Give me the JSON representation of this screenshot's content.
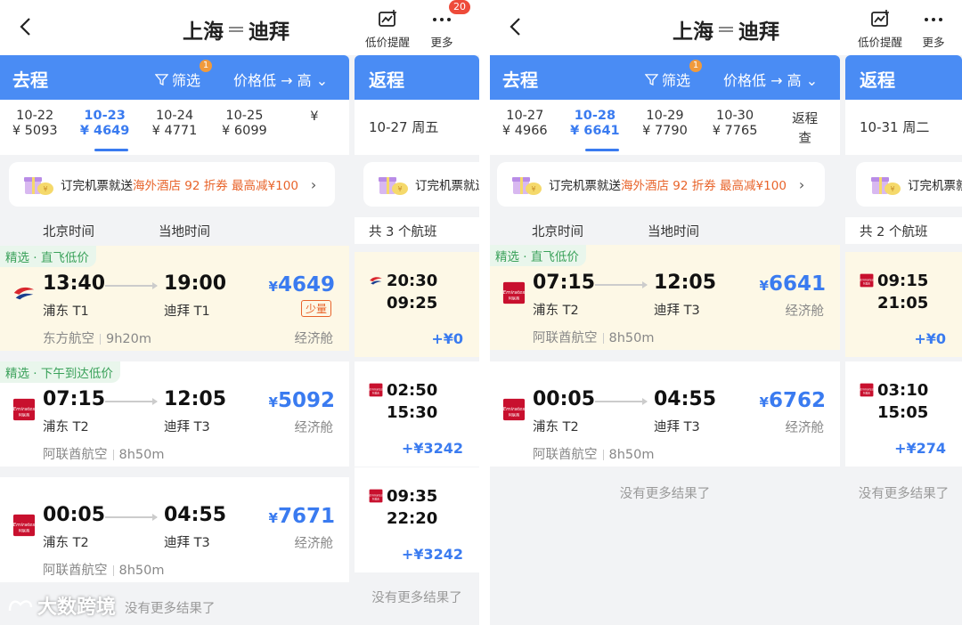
{
  "left": {
    "route_from": "上海",
    "route_to": "迪拜",
    "price_alert_label": "低价提醒",
    "more_label": "更多",
    "more_badge": "20",
    "outbound_label": "去程",
    "filter_label": "筛选",
    "filter_badge": "1",
    "sort_label": "价格低 → 高",
    "return_label": "返程",
    "dates": [
      {
        "date": "10-22",
        "price": "¥ 5093"
      },
      {
        "date": "10-23",
        "price": "¥ 4649"
      },
      {
        "date": "10-24",
        "price": "¥ 4771"
      },
      {
        "date": "10-25",
        "price": "¥ 6099"
      },
      {
        "date": "",
        "price": "¥"
      }
    ],
    "active_date_index": 1,
    "return_date": "10-27 周五",
    "promo_prefix": "订完机票就送",
    "promo_highlight": "海外酒店 92 折券 最高减¥100",
    "promo_short": "订完机票就送",
    "col_beijing": "北京时间",
    "col_local": "当地时间",
    "return_count": "共 3 个航班",
    "flights": [
      {
        "tag": "精选 · 直飞低价",
        "dep": "13:40",
        "arr": "19:00",
        "dep_ap": "浦东 T1",
        "arr_ap": "迪拜 T1",
        "price": "4649",
        "few": "少量",
        "airline": "东方航空",
        "duration": "9h20m",
        "cabin": "经济舱",
        "logo": "china-eastern"
      },
      {
        "tag": "精选 · 下午到达低价",
        "dep": "07:15",
        "arr": "12:05",
        "dep_ap": "浦东 T2",
        "arr_ap": "迪拜 T3",
        "price": "5092",
        "airline": "阿联酋航空",
        "duration": "8h50m",
        "cabin": "经济舱",
        "logo": "emirates"
      },
      {
        "tag": "",
        "dep": "00:05",
        "arr": "04:55",
        "dep_ap": "浦东 T2",
        "arr_ap": "迪拜 T3",
        "price": "7671",
        "airline": "阿联酋航空",
        "duration": "8h50m",
        "cabin": "经济舱",
        "logo": "emirates"
      }
    ],
    "returns": [
      {
        "dep": "20:30",
        "arr": "09:25",
        "diff": "+¥0",
        "logo": "china-eastern"
      },
      {
        "dep": "02:50",
        "arr": "15:30",
        "diff": "+¥3242",
        "logo": "emirates"
      },
      {
        "dep": "09:35",
        "arr": "22:20",
        "diff": "+¥3242",
        "logo": "emirates"
      }
    ],
    "no_more": "没有更多结果了",
    "watermark": "大数跨境"
  },
  "right": {
    "route_from": "上海",
    "route_to": "迪拜",
    "price_alert_label": "低价提醒",
    "more_label": "更多",
    "outbound_label": "去程",
    "filter_label": "筛选",
    "filter_badge": "1",
    "sort_label": "价格低 → 高",
    "return_label": "返程",
    "dates": [
      {
        "date": "10-27",
        "price": "¥ 4966"
      },
      {
        "date": "10-28",
        "price": "¥ 6641"
      },
      {
        "date": "10-29",
        "price": "¥ 7790"
      },
      {
        "date": "10-30",
        "price": "¥ 7765"
      },
      {
        "date": "返程",
        "price": "查"
      }
    ],
    "active_date_index": 1,
    "return_date": "10-31 周二",
    "promo_prefix": "订完机票就送",
    "promo_highlight": "海外酒店 92 折券 最高减¥100",
    "promo_short": "订完机票就",
    "col_beijing": "北京时间",
    "col_local": "当地时间",
    "return_count": "共 2 个航班",
    "flights": [
      {
        "tag": "精选 · 直飞低价",
        "dep": "07:15",
        "arr": "12:05",
        "dep_ap": "浦东 T2",
        "arr_ap": "迪拜 T3",
        "price": "6641",
        "airline": "阿联酋航空",
        "duration": "8h50m",
        "cabin": "经济舱",
        "logo": "emirates"
      },
      {
        "tag": "",
        "dep": "00:05",
        "arr": "04:55",
        "dep_ap": "浦东 T2",
        "arr_ap": "迪拜 T3",
        "price": "6762",
        "airline": "阿联酋航空",
        "duration": "8h50m",
        "cabin": "经济舱",
        "logo": "emirates"
      }
    ],
    "returns": [
      {
        "dep": "09:15",
        "arr": "21:05",
        "diff": "+¥0",
        "logo": "emirates"
      },
      {
        "dep": "03:10",
        "arr": "15:05",
        "diff": "+¥274",
        "logo": "emirates"
      }
    ],
    "no_more": "没有更多结果了"
  },
  "colors": {
    "accent": "#3a7bf0",
    "header_blue": "#4a8cf4",
    "highlight_bg": "#fdf8e6",
    "tag_green": "#3aa15a",
    "orange": "#e8642b"
  }
}
